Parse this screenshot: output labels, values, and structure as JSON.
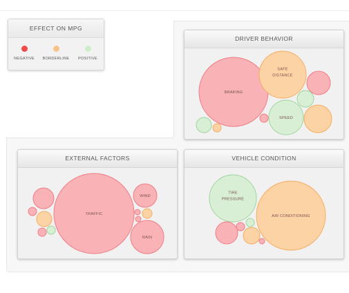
{
  "colors": {
    "negative": {
      "fill": "#f9b3b6",
      "stroke": "#ef7d85"
    },
    "borderline": {
      "fill": "#fcd3a5",
      "stroke": "#f5ad63"
    },
    "positive": {
      "fill": "#d8efd6",
      "stroke": "#9ed69b"
    }
  },
  "legend": {
    "title": "EFFECT ON MPG",
    "items": [
      {
        "label": "NEGATIVE",
        "color": "#ef4b4b"
      },
      {
        "label": "BORDERLINE",
        "color": "#f8c38b"
      },
      {
        "label": "POSITIVE",
        "color": "#cdeecb"
      }
    ]
  },
  "cards": {
    "driver": {
      "title": "DRIVER BEHAVIOR"
    },
    "external": {
      "title": "EXTERNAL FACTORS"
    },
    "vehicle": {
      "title": "VEHICLE CONDITION"
    }
  },
  "bubbles": {
    "braking": {
      "label": [
        "BRAKING"
      ],
      "effect": "negative"
    },
    "safe_distance": {
      "label": [
        "SAFE",
        "DISTANCE"
      ],
      "effect": "borderline"
    },
    "speed": {
      "label": [
        "SPEED"
      ],
      "effect": "positive"
    },
    "traffic": {
      "label": [
        "TRAFFIC"
      ],
      "effect": "negative"
    },
    "wind": {
      "label": [
        "WIND"
      ],
      "effect": "negative"
    },
    "rain": {
      "label": [
        "RAIN"
      ],
      "effect": "negative"
    },
    "tire_pressure": {
      "label": [
        "TIRE",
        "PRESSURE"
      ],
      "effect": "positive"
    },
    "air_conditioning": {
      "label": [
        "AIR CONDITIONING"
      ],
      "effect": "borderline"
    }
  }
}
